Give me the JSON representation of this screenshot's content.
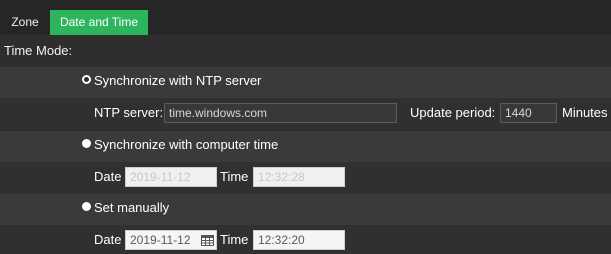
{
  "tabs": [
    {
      "label": "Zone",
      "active": false
    },
    {
      "label": "Date and Time",
      "active": true
    }
  ],
  "section_title": "Time Mode:",
  "ntp": {
    "option_label": "Synchronize with NTP server",
    "selected": true,
    "server_label": "NTP server:",
    "server_value": "time.windows.com",
    "period_label": "Update period:",
    "period_value": "1440",
    "unit_label": "Minutes"
  },
  "computer_time": {
    "option_label": "Synchronize with computer time",
    "selected": false,
    "date_label": "Date",
    "date_value": "2019-11-12",
    "time_label": "Time",
    "time_value": "12:32:28"
  },
  "manual": {
    "option_label": "Set manually",
    "selected": false,
    "date_label": "Date",
    "date_value": "2019-11-12",
    "time_label": "Time",
    "time_value": "12:32:20"
  },
  "colors": {
    "accent": "#2db55d",
    "background": "#2e2e2e"
  },
  "icons": {
    "calendar": "calendar-icon"
  }
}
